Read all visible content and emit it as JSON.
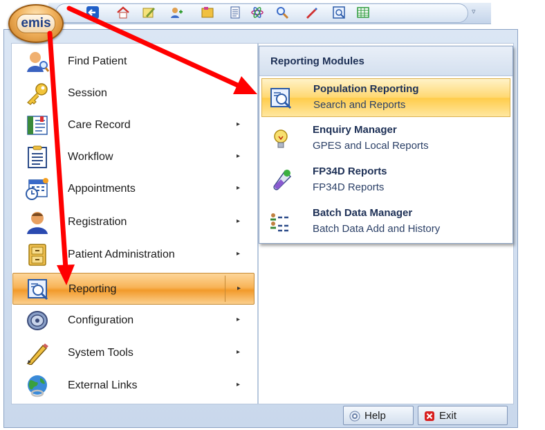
{
  "app": {
    "logo_text": "emis"
  },
  "quick_access": {
    "icons": [
      "back-arrow-icon",
      "home-icon",
      "edit-icon",
      "patient-icon",
      "folder-icon",
      "document-icon",
      "atom-icon",
      "search-icon",
      "pen-icon",
      "report-icon",
      "table-icon"
    ],
    "more": "▿"
  },
  "main_menu": {
    "items": [
      {
        "label": "Find Patient",
        "icon": "find-patient-icon",
        "has_submenu": false
      },
      {
        "label": "Session",
        "icon": "key-icon",
        "has_submenu": true
      },
      {
        "label": "Care Record",
        "icon": "care-record-icon",
        "has_submenu": true
      },
      {
        "label": "Workflow",
        "icon": "workflow-icon",
        "has_submenu": true
      },
      {
        "label": "Appointments",
        "icon": "calendar-clock-icon",
        "has_submenu": true
      },
      {
        "label": "Registration",
        "icon": "person-icon",
        "has_submenu": true
      },
      {
        "label": "Patient Administration",
        "icon": "filing-cabinet-icon",
        "has_submenu": true
      },
      {
        "label": "Reporting",
        "icon": "reporting-icon",
        "has_submenu": true,
        "active": true
      },
      {
        "label": "Configuration",
        "icon": "configuration-icon",
        "has_submenu": true
      },
      {
        "label": "System Tools",
        "icon": "pencil-icon",
        "has_submenu": true
      },
      {
        "label": "External Links",
        "icon": "globe-icon",
        "has_submenu": true
      }
    ],
    "arrow_glyph": "▸"
  },
  "submenu": {
    "header": "Reporting Modules",
    "items": [
      {
        "title": "Population Reporting",
        "subtitle": "Search and Reports",
        "icon": "population-report-icon",
        "highlighted": true
      },
      {
        "title": "Enquiry Manager",
        "subtitle": "GPES and Local Reports",
        "icon": "lightbulb-icon"
      },
      {
        "title": "FP34D Reports",
        "subtitle": "FP34D Reports",
        "icon": "test-tube-icon"
      },
      {
        "title": "Batch Data Manager",
        "subtitle": "Batch Data Add and History",
        "icon": "batch-list-icon"
      }
    ]
  },
  "footer": {
    "help_label": "Help",
    "exit_label": "Exit"
  },
  "colors": {
    "annotation_red": "#ff0000",
    "active_orange": "#f29a2a",
    "hover_yellow": "#ffd870",
    "frame_blue": "#c9d8ec"
  }
}
